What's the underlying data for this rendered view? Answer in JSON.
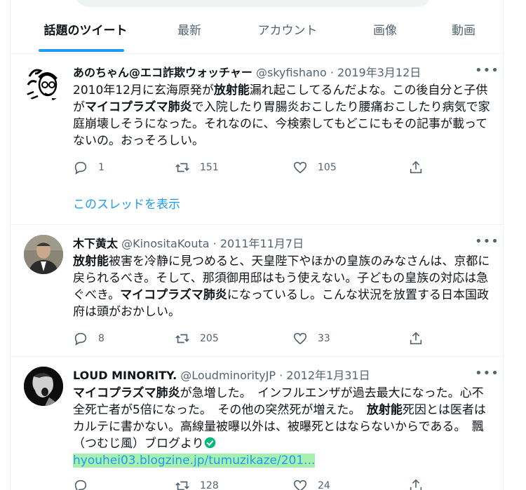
{
  "tabs": [
    {
      "label": "話題のツイート",
      "active": true
    },
    {
      "label": "最新",
      "active": false
    },
    {
      "label": "アカウント",
      "active": false
    },
    {
      "label": "画像",
      "active": false
    },
    {
      "label": "動画",
      "active": false
    }
  ],
  "colors": {
    "accent": "#1d9bf0",
    "text": "#0f1419",
    "muted": "#536471",
    "highlight": "#a8f0b0",
    "verified": "#00ba7c"
  },
  "tweets": [
    {
      "name": "あのちゃん@エコ詐欺ウォッチャー",
      "handle": "@skyfishano",
      "date": "2019年3月12日",
      "text_parts": [
        "2010年12月に玄海原発が",
        "放射能",
        "漏れ起こしてるんだよな。この後自分と子供が",
        "マイコプラズマ肺炎",
        "で入院したり胃腸炎おこしたり腰痛おこしたり病気で家庭崩壊しそうになった。それなのに、今検索してもどこにもその記事が載ってないの。おっそろしい。"
      ],
      "replies": "1",
      "retweets": "151",
      "likes": "105",
      "thread_label": "このスレッドを表示",
      "avatar_icon": "sketch-avatar"
    },
    {
      "name": "木下黄太",
      "handle": "@KinositaKouta",
      "date": "2011年11月7日",
      "text_parts": [
        "放射能",
        "被害を冷静に見つめると、天皇陛下やほかの皇族のみなさんは、京都に戻られるべき。そして、那須御用邸はもう使えない。子どもの皇族の対応は急ぐべき。",
        "マイコプラズマ肺炎",
        "になっているし。こんな状況を放置する日本国政府は頭がおかしい。"
      ],
      "replies": "8",
      "retweets": "205",
      "likes": "33",
      "avatar_icon": "photo-avatar"
    },
    {
      "name": "LOUD MINORITY.",
      "handle": "@LoudminorityJP",
      "date": "2012年1月31日",
      "text_parts": [
        "マイコプラズマ肺炎",
        "が急増した。　インフルエンザが過去最大になった。心不全死亡者が5倍になった。　その他の突然死が増えた。　",
        "放射能",
        "死因とは医者はカルテに書かない。高線量被曝以外は、被曝死とはならないからである。　飄（つむじ風）ブログより"
      ],
      "link": "hyouhei03.blogzine.jp/tumuzikaze/201...",
      "replies": "",
      "retweets": "128",
      "likes": "24",
      "avatar_icon": "photo-avatar"
    }
  ]
}
